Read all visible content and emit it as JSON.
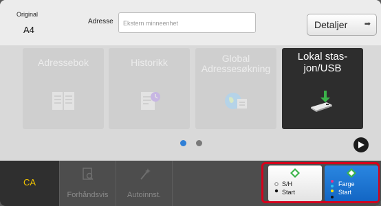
{
  "header": {
    "original_label": "Original",
    "original_value": "A4",
    "address_label": "Adresse",
    "address_placeholder": "Ekstern minneenhet",
    "details_label": "Detaljer"
  },
  "tiles": [
    {
      "label": "Adressebok",
      "icon": "address-book-icon",
      "active": false
    },
    {
      "label": "Historikk",
      "icon": "history-icon",
      "active": false
    },
    {
      "label": "Global Adressesøkning",
      "icon": "global-search-icon",
      "active": false
    },
    {
      "label": "Lokal stas-jon/USB",
      "icon": "usb-icon",
      "active": true
    }
  ],
  "pager": {
    "pages": 2,
    "current": 1
  },
  "bottom_bar": {
    "ca_label": "CA",
    "preview_label": "Forhåndsvis",
    "autoset_label": "Autoinnst."
  },
  "start": {
    "bw_line1": "S/H",
    "bw_line2": "Start",
    "color_line1": "Farge",
    "color_line2": "Start"
  },
  "colors": {
    "accent_blue": "#2f7fd6",
    "highlight_red": "#d6001c",
    "ca_yellow": "#f3c500",
    "start_green": "#3bb34a"
  }
}
